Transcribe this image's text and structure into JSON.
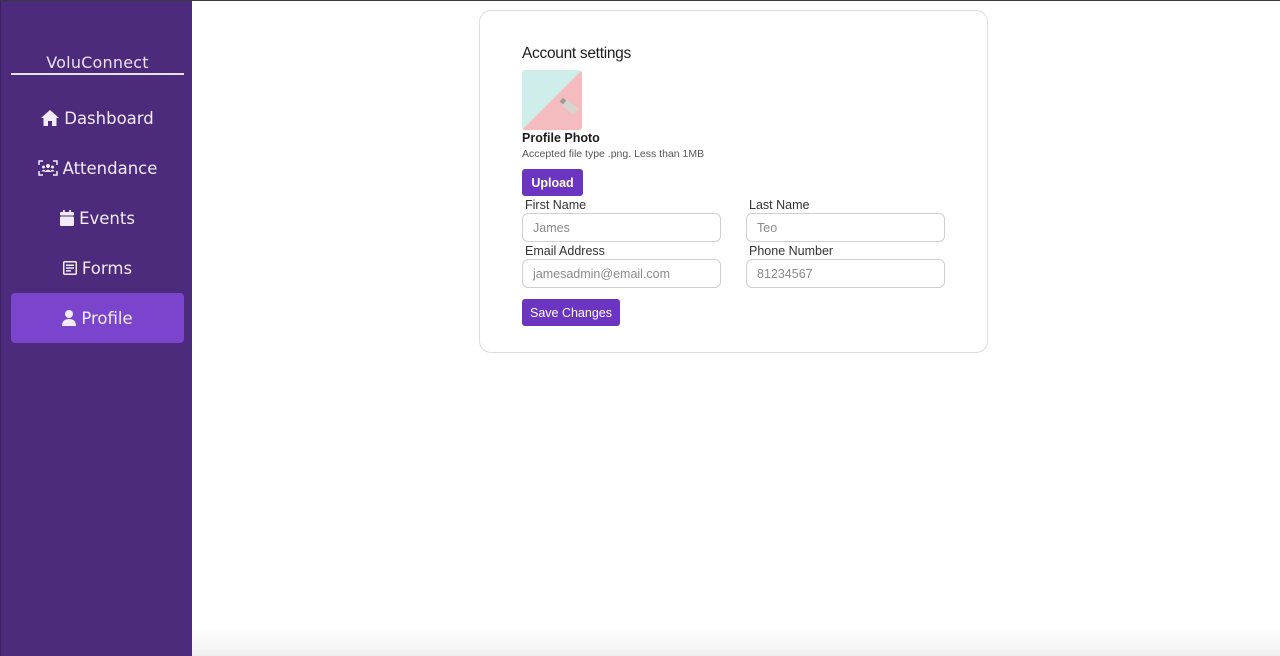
{
  "app": {
    "brand": "VoluConnect"
  },
  "sidebar": {
    "items": [
      {
        "label": "Dashboard",
        "icon": "home-icon"
      },
      {
        "label": "Attendance",
        "icon": "attendance-icon"
      },
      {
        "label": "Events",
        "icon": "calendar-icon"
      },
      {
        "label": "Forms",
        "icon": "form-icon"
      },
      {
        "label": "Profile",
        "icon": "user-icon",
        "active": true
      }
    ]
  },
  "account": {
    "title": "Account settings",
    "photo_label": "Profile Photo",
    "photo_hint": "Accepted file type .png. Less than 1MB",
    "upload_label": "Upload",
    "save_label": "Save Changes",
    "fields": {
      "first_name": {
        "label": "First Name",
        "placeholder": "James",
        "value": ""
      },
      "last_name": {
        "label": "Last Name",
        "placeholder": "Teo",
        "value": ""
      },
      "email": {
        "label": "Email Address",
        "placeholder": "jamesadmin@email.com",
        "value": ""
      },
      "phone": {
        "label": "Phone Number",
        "placeholder": "81234567",
        "value": ""
      }
    }
  },
  "colors": {
    "sidebar_bg": "#4c2a7c",
    "active_item": "#7a45cc",
    "button": "#6b35c2"
  }
}
